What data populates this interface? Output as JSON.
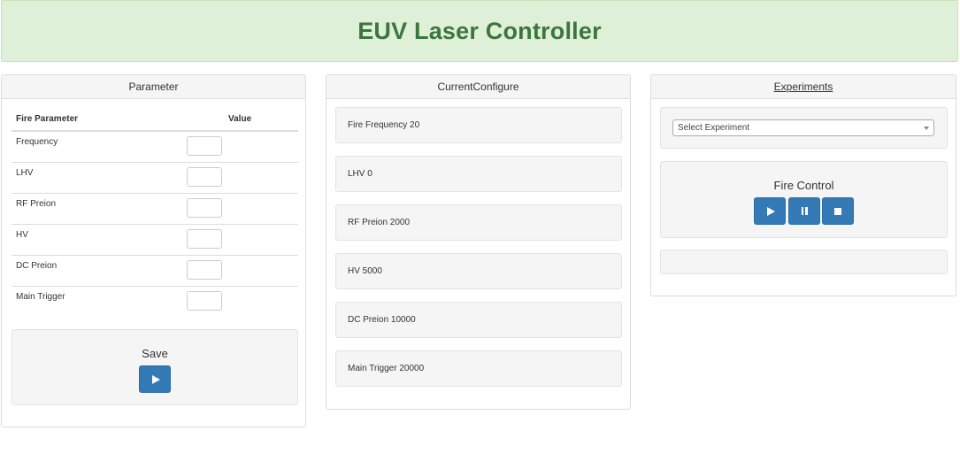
{
  "app": {
    "title": "EUV Laser Controller"
  },
  "parameter_panel": {
    "heading": "Parameter",
    "columns": [
      "Fire Parameter",
      "Value"
    ],
    "rows": [
      {
        "label": "Frequency",
        "value": ""
      },
      {
        "label": "LHV",
        "value": ""
      },
      {
        "label": "RF Preion",
        "value": ""
      },
      {
        "label": "HV",
        "value": ""
      },
      {
        "label": "DC Preion",
        "value": ""
      },
      {
        "label": "Main Trigger",
        "value": ""
      }
    ],
    "save_label": "Save",
    "save_icon": "play-icon"
  },
  "config_panel": {
    "heading": "CurrentConfigure",
    "items": [
      "Fire Frequency 20",
      "LHV 0",
      "RF Preion 2000",
      "HV 5000",
      "DC Preion 10000",
      "Main Trigger 20000"
    ]
  },
  "experiments_panel": {
    "heading": "Experiments",
    "select_value": "Select Experiment",
    "fire_control_label": "Fire Control",
    "fire_buttons": [
      "play-icon",
      "pause-icon",
      "stop-icon"
    ],
    "status_text": ""
  },
  "colors": {
    "header_bg": "#dff0d8",
    "header_text": "#3c763d",
    "button_primary": "#337ab7",
    "well_bg": "#f5f5f5"
  }
}
